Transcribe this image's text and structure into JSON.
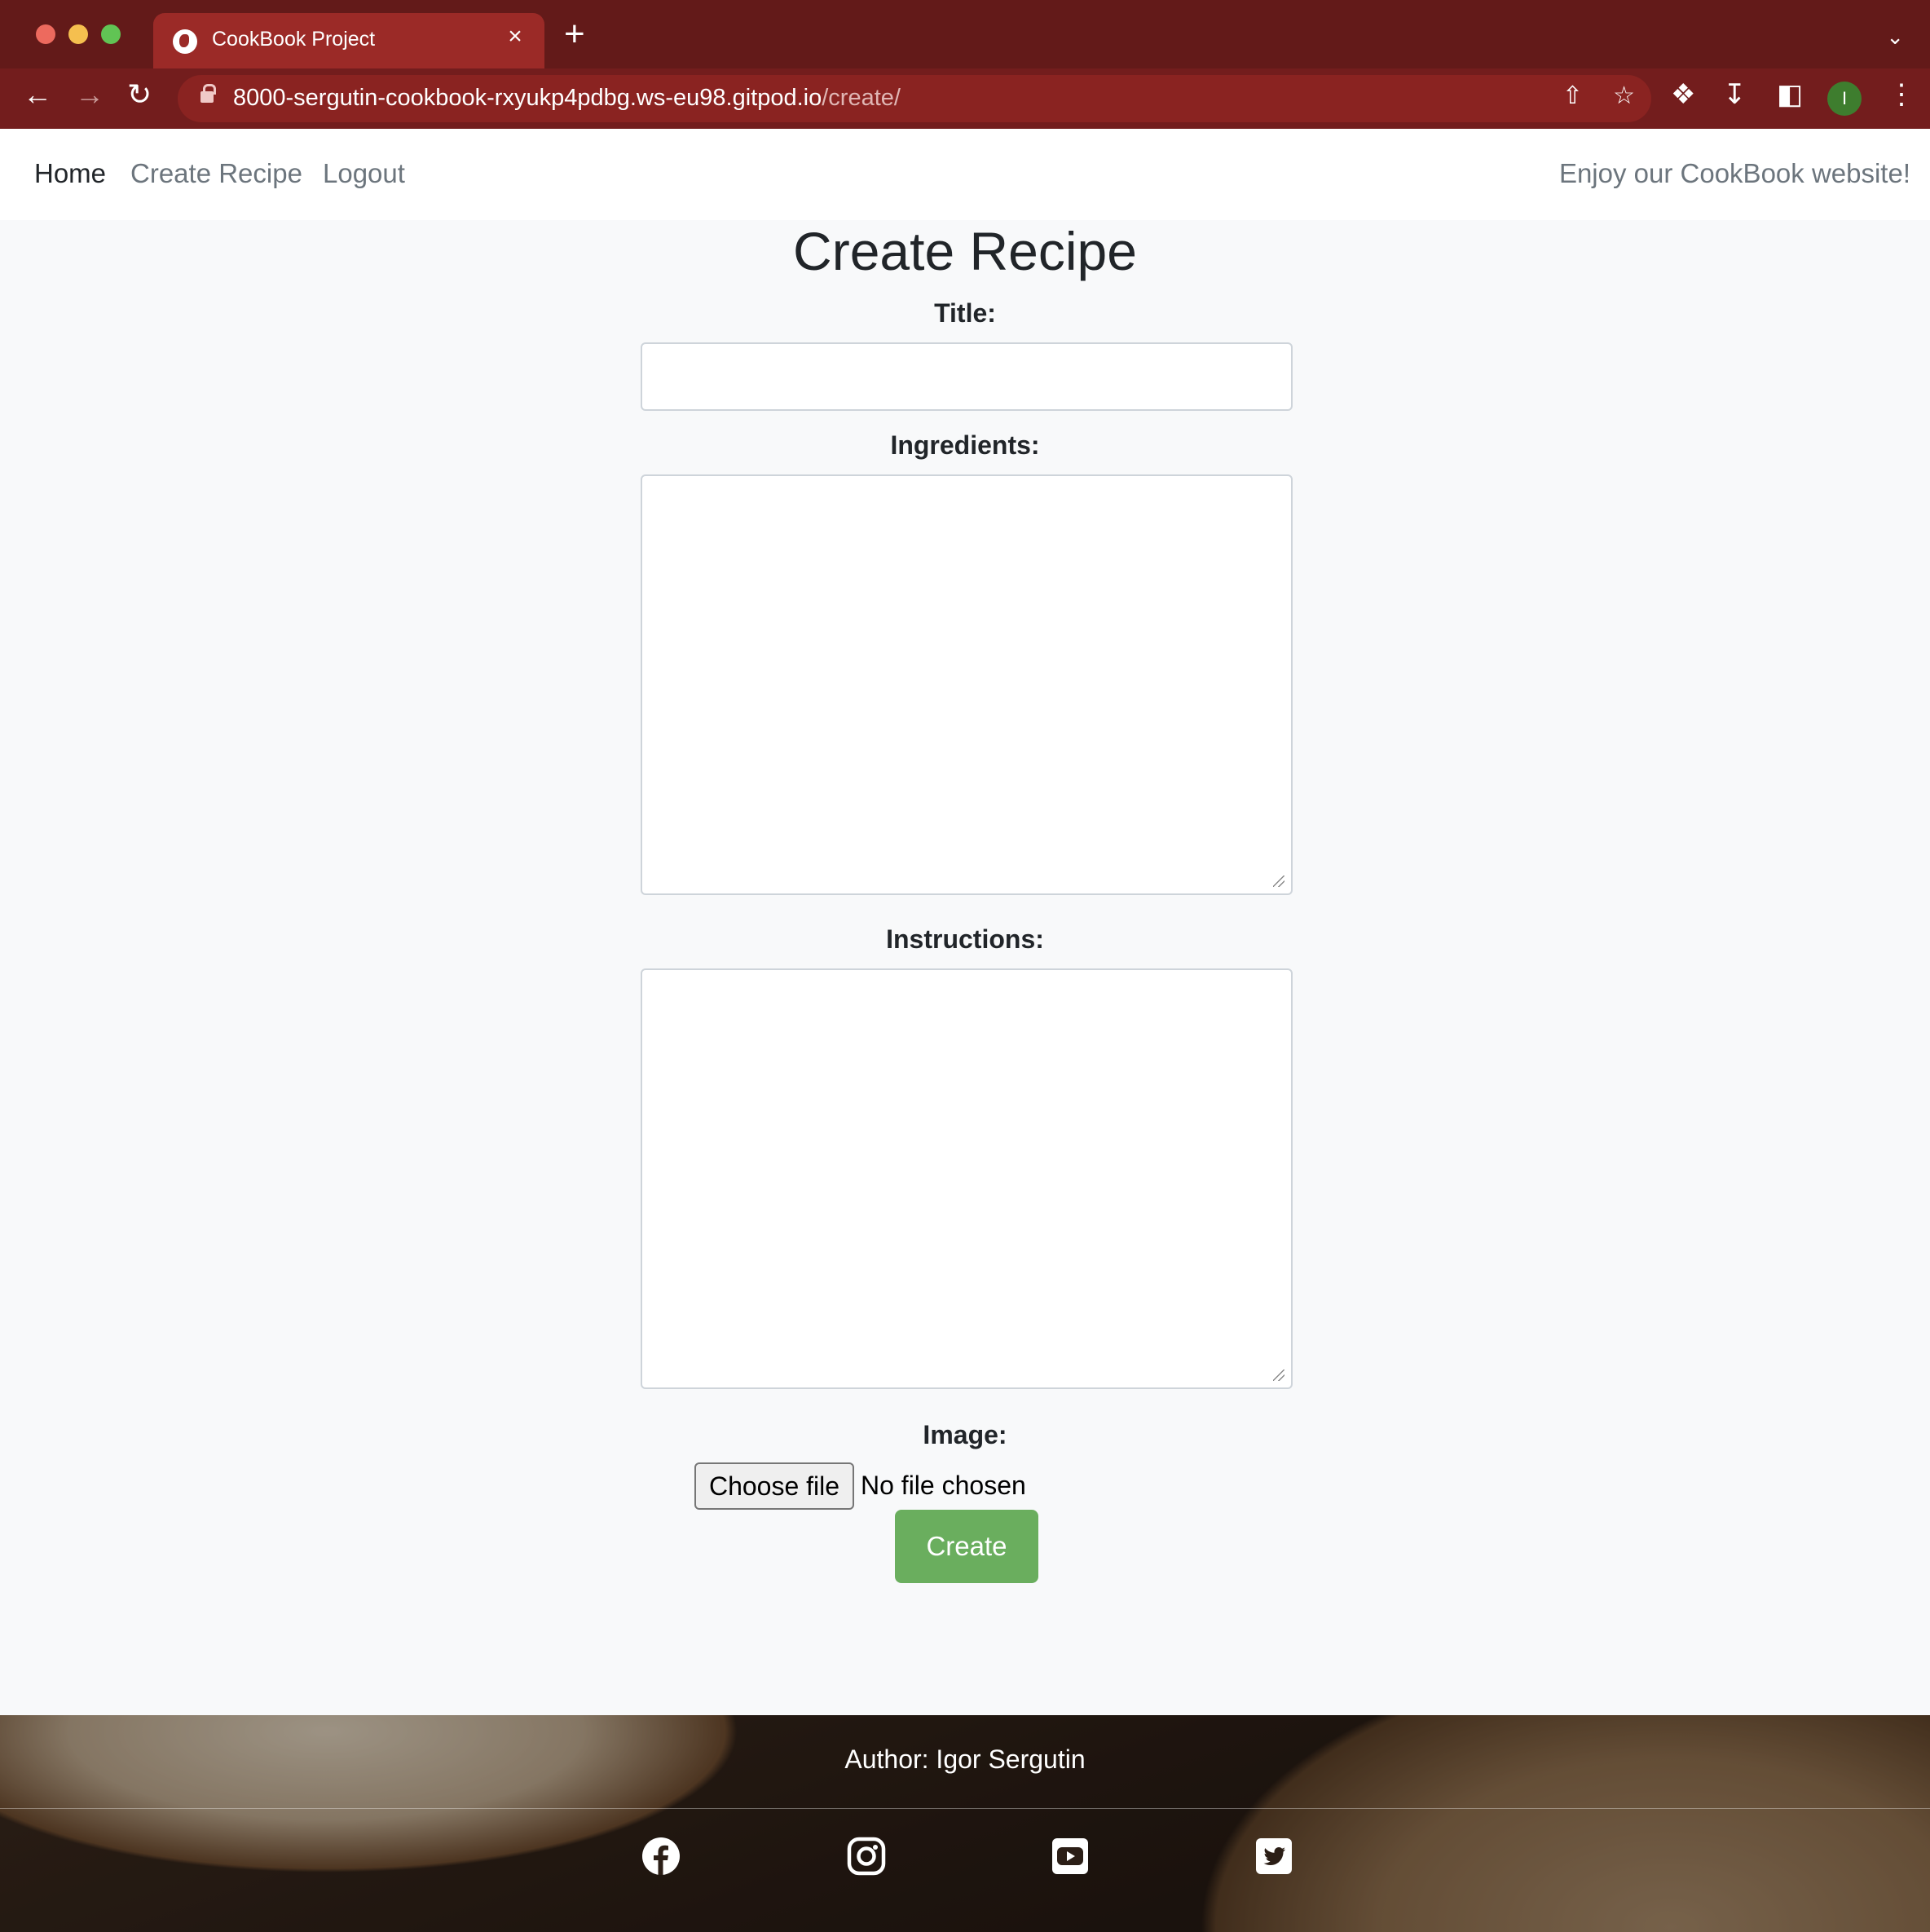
{
  "browser": {
    "tab_title": "CookBook Project",
    "tab_close": "×",
    "new_tab": "+",
    "url_host": "8000-sergutin-cookbook-rxyukp4pdbg.ws-eu98.gitpod.io",
    "url_path": "/create/",
    "profile_initial": "I",
    "icons": [
      "globe-icon",
      "back-icon",
      "forward-icon",
      "reload-icon",
      "lock-icon",
      "share-icon",
      "star-icon",
      "puzzle-icon",
      "download-icon",
      "sidepanel-icon",
      "more-icon",
      "chevron-down-icon"
    ]
  },
  "nav": {
    "home": "Home",
    "create_recipe": "Create Recipe",
    "logout": "Logout",
    "tagline": "Enjoy our CookBook website!"
  },
  "form": {
    "heading": "Create Recipe",
    "title_label": "Title:",
    "title_value": "",
    "ingredients_label": "Ingredients:",
    "ingredients_value": "",
    "instructions_label": "Instructions:",
    "instructions_value": "",
    "image_label": "Image:",
    "choose_file": "Choose file",
    "file_status": "No file chosen",
    "submit": "Create",
    "submit_color": "#6aae5e"
  },
  "footer": {
    "author": "Author: Igor Sergutin",
    "social_icons": [
      "facebook-icon",
      "instagram-icon",
      "youtube-icon",
      "twitter-icon"
    ]
  }
}
